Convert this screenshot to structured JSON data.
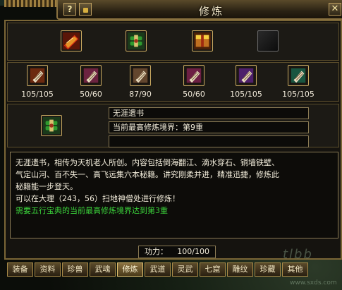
{
  "window": {
    "title": "修炼",
    "help_label": "?",
    "close_label": "✕"
  },
  "top_items": [
    {
      "name": "red-book-icon",
      "colors": [
        "#d02a10",
        "#f0c030"
      ]
    },
    {
      "name": "green-scroll-icon",
      "colors": [
        "#2e9a2e",
        "#d8c070"
      ]
    },
    {
      "name": "golden-box-icon",
      "colors": [
        "#c07020",
        "#f8d040"
      ]
    },
    {
      "name": "empty-slot",
      "colors": [
        "#2a2a2a",
        "#0c0c0c"
      ]
    }
  ],
  "scrolls": [
    {
      "name": "red-scroll-icon",
      "color": "#b03a10",
      "count": "105/105"
    },
    {
      "name": "pink-scroll-icon",
      "color": "#b0306a",
      "count": "50/60"
    },
    {
      "name": "tan-scroll-icon",
      "color": "#a07048",
      "count": "87/90"
    },
    {
      "name": "magenta-scroll-icon",
      "color": "#b02870",
      "count": "50/60"
    },
    {
      "name": "purple-scroll-icon",
      "color": "#7a2ab8",
      "count": "105/105"
    },
    {
      "name": "teal-scroll-icon",
      "color": "#1a8a6a",
      "count": "105/105"
    }
  ],
  "selected_item": {
    "name": "selected-green-scroll-icon",
    "title": "无涯遗书",
    "realm": "当前最高修炼境界：第9重",
    "extra": ""
  },
  "description": {
    "line1": "无涯遗书，相传为天机老人所创。内容包括倒海翻江、滴水穿石、铜墙铁壁、",
    "line2": "气定山河、百不失一、高飞远集六本秘籍。讲究刚柔并进，精准迅捷，修炼此",
    "line3": "秘籍能一步登天。",
    "line4": "可以在大理（243，56）扫地神僧处进行修炼！",
    "requirement": "需要五行宝典的当前最高修炼境界达到第3重"
  },
  "power": {
    "label": "功力：",
    "value": "100/100"
  },
  "tabs": [
    {
      "label": "装备",
      "active": false
    },
    {
      "label": "资料",
      "active": false
    },
    {
      "label": "珍兽",
      "active": false
    },
    {
      "label": "武魂",
      "active": false
    },
    {
      "label": "修炼",
      "active": true
    },
    {
      "label": "武道",
      "active": false
    },
    {
      "label": "灵武",
      "active": false
    },
    {
      "label": "七窟",
      "active": false
    },
    {
      "label": "雕纹",
      "active": false
    },
    {
      "label": "珍藏",
      "active": false
    },
    {
      "label": "其他",
      "active": false
    }
  ],
  "colors": {
    "border_gold": "#c8a860",
    "requirement_green": "#3ad23a",
    "panel_bg": "#15130f"
  }
}
